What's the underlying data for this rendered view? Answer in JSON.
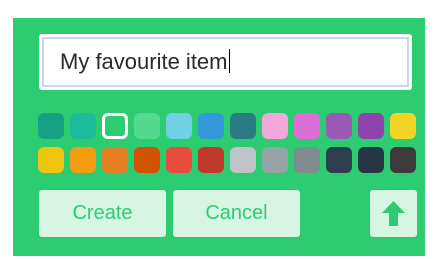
{
  "form": {
    "name_value": "My favourite item"
  },
  "palette": {
    "selected_index": 2,
    "colors": [
      "#16a085",
      "#1abc9c",
      "#2ecc71",
      "#55d98d",
      "#6fd0e8",
      "#3498db",
      "#2c7a86",
      "#f3a8dc",
      "#da70d6",
      "#9b59b6",
      "#8e44ad",
      "#f1d526",
      "#f1c40f",
      "#f39c12",
      "#e67e22",
      "#d35400",
      "#e74c3c",
      "#c0392b",
      "#bdc3c7",
      "#95a5a6",
      "#7f8c8d",
      "#2c3e50",
      "#273646",
      "#3b3b3b"
    ]
  },
  "buttons": {
    "create_label": "Create",
    "cancel_label": "Cancel",
    "up_icon": "arrow-up-icon"
  },
  "theme": {
    "panel": "#2ecc71",
    "button_bg": "#d6f5e2",
    "button_text": "#2ecc71",
    "arrow": "#2ecc71"
  }
}
